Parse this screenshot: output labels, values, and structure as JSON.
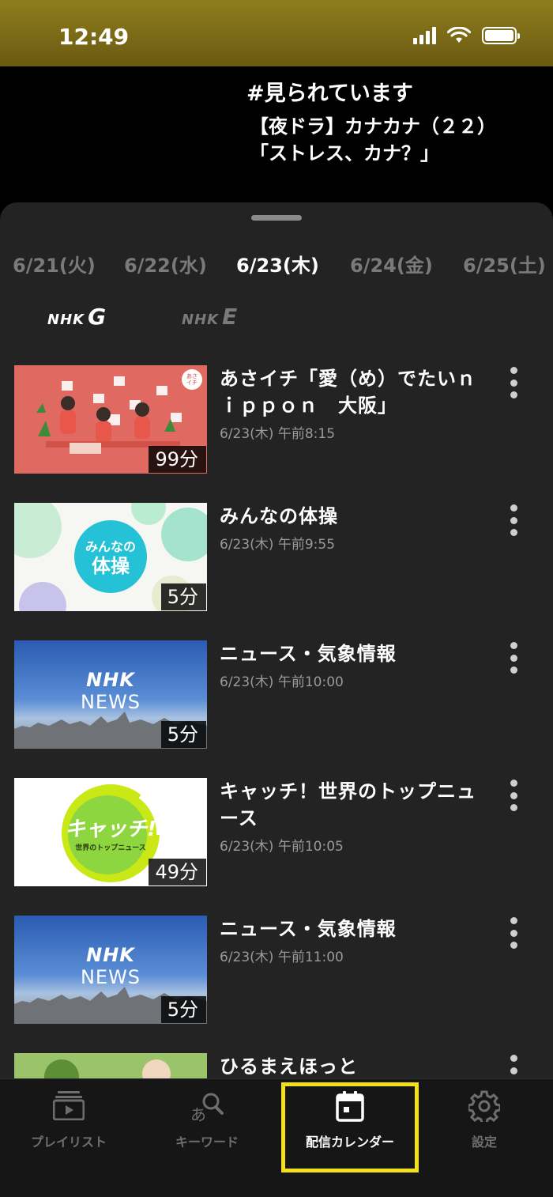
{
  "status_bar": {
    "time": "12:49"
  },
  "now_playing": {
    "tag": "#見られています",
    "title_line1": "【夜ドラ】カナカナ（２２）",
    "title_line2": "「ストレス、カナ？」"
  },
  "date_tabs": [
    "6/21(火)",
    "6/22(水)",
    "6/23(木)",
    "6/24(金)",
    "6/25(土)"
  ],
  "active_date_index": 2,
  "channel_tabs": [
    {
      "brand": "NHK",
      "channel": "G",
      "active": true
    },
    {
      "brand": "NHK",
      "channel": "E",
      "active": false
    }
  ],
  "programs": [
    {
      "title": "あさイチ「愛（め）でたいｎｉｐｐｏｎ　大阪」",
      "datetime": "6/23(木) 午前8:15",
      "duration": "99分",
      "thumb": "asaichi",
      "thumb_badge": "あさイチ"
    },
    {
      "title": "みんなの体操",
      "datetime": "6/23(木) 午前9:55",
      "duration": "5分",
      "thumb": "taiso",
      "thumb_text1": "みんなの",
      "thumb_text2": "体操"
    },
    {
      "title": "ニュース・気象情報",
      "datetime": "6/23(木) 午前10:00",
      "duration": "5分",
      "thumb": "news",
      "thumb_text1": "NHK",
      "thumb_text2": "NEWS"
    },
    {
      "title": "キャッチ！世界のトップニュース",
      "datetime": "6/23(木) 午前10:05",
      "duration": "49分",
      "thumb": "catch",
      "thumb_text1": "キャッチ!",
      "thumb_text2": "世界のトップニュース"
    },
    {
      "title": "ニュース・気象情報",
      "datetime": "6/23(木) 午前11:00",
      "duration": "5分",
      "thumb": "news",
      "thumb_text1": "NHK",
      "thumb_text2": "NEWS"
    },
    {
      "title": "ひるまえほっと",
      "datetime": "",
      "duration": "",
      "thumb": "hiru"
    }
  ],
  "bottom_nav": [
    {
      "label": "プレイリスト",
      "icon": "playlist-icon",
      "active": false
    },
    {
      "label": "キーワード",
      "icon": "keyword-search-icon",
      "active": false
    },
    {
      "label": "配信カレンダー",
      "icon": "calendar-icon",
      "active": true
    },
    {
      "label": "設定",
      "icon": "gear-icon",
      "active": false
    }
  ],
  "colors": {
    "highlight": "#f3e01a",
    "status_bar": "#8f7d1c",
    "sheet": "#232323"
  }
}
